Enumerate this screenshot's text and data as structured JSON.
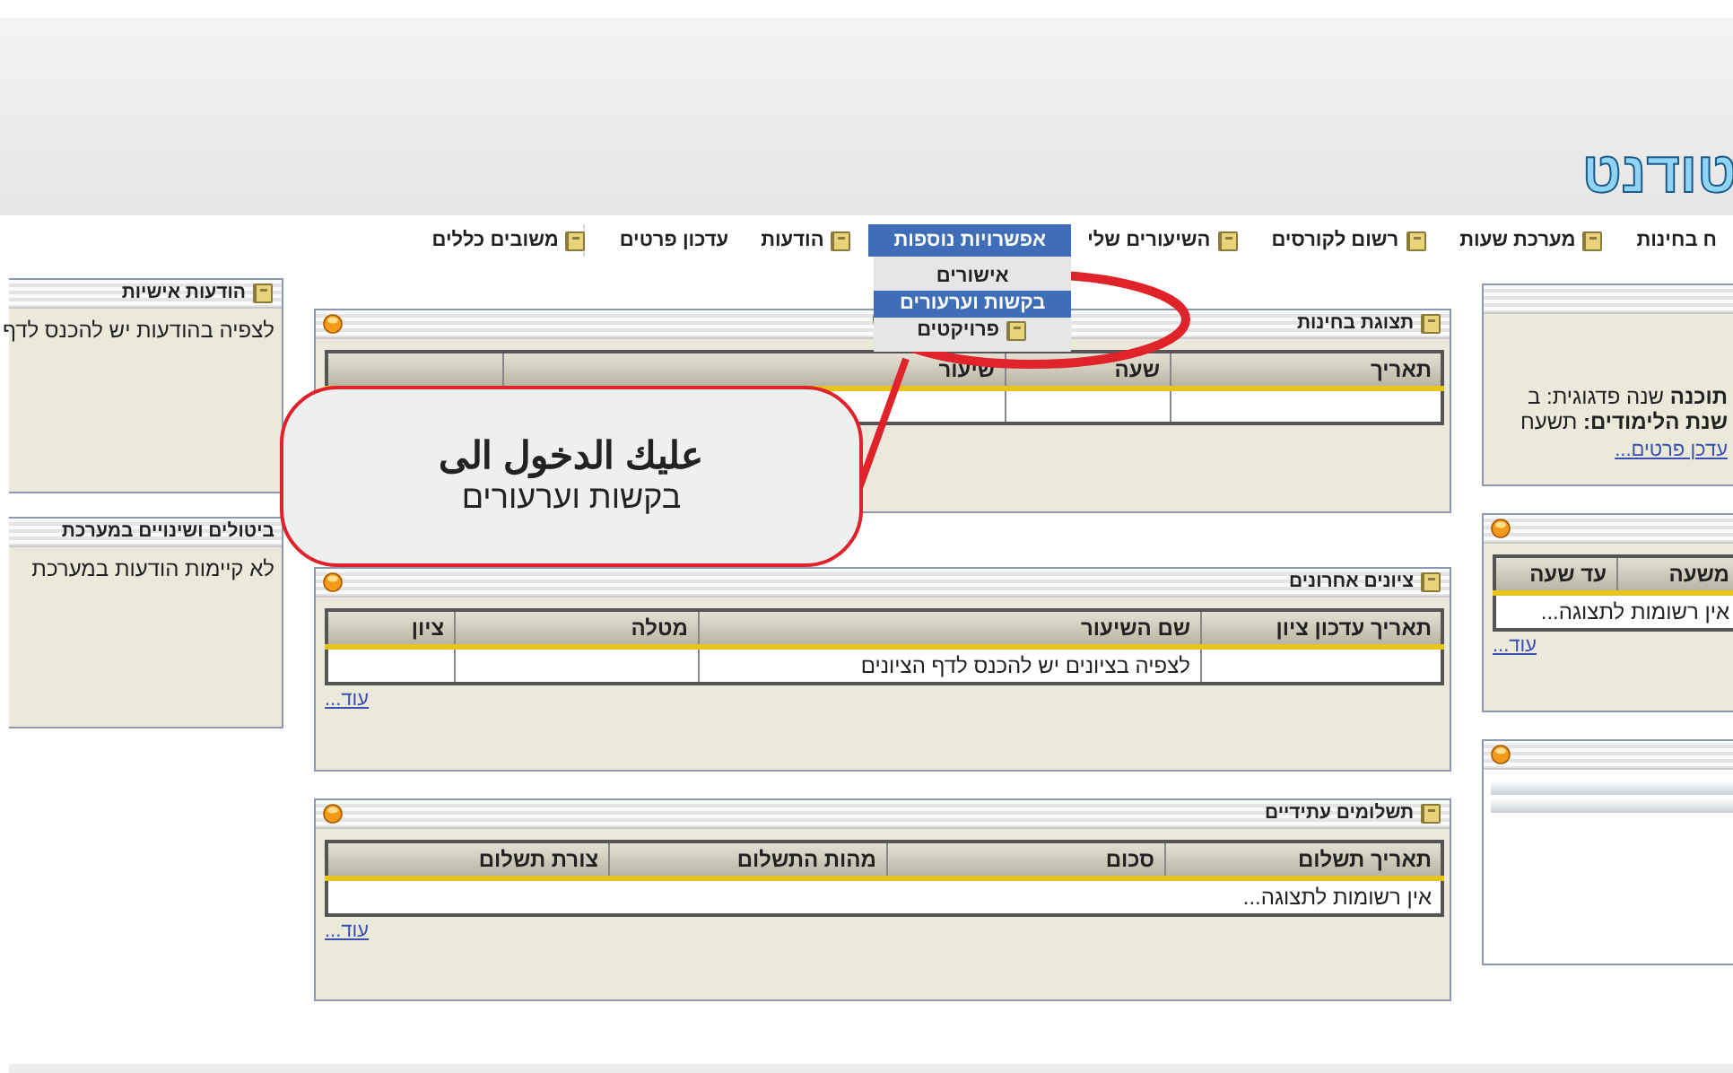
{
  "header": {
    "logo": "טודנט"
  },
  "nav": [
    {
      "label": "ח בחינות",
      "selected": false,
      "kind": "plain"
    },
    {
      "label": "מערכת שעות",
      "selected": false,
      "kind": "icon"
    },
    {
      "label": "רשום לקורסים",
      "selected": false,
      "kind": "icon"
    },
    {
      "label": "השיעורים שלי",
      "selected": false,
      "kind": "icon"
    },
    {
      "label": "אפשרויות נוספות",
      "selected": true,
      "kind": "plain",
      "menu": [
        {
          "label": "אישורים",
          "selected": false,
          "kind": "plain"
        },
        {
          "label": "בקשות וערעורים",
          "selected": true,
          "kind": "plain"
        },
        {
          "label": "פרויקטים",
          "selected": false,
          "kind": "icon"
        }
      ]
    },
    {
      "label": "הודעות",
      "selected": false,
      "kind": "icon"
    },
    {
      "label": "עדכון פרטים",
      "selected": false,
      "kind": "plain"
    },
    {
      "label": "משובים כללים",
      "selected": false,
      "kind": "icon"
    }
  ],
  "left_panels": [
    {
      "title": "הודעות אישיות",
      "text": "לצפיה בהודעות יש להכנס לדף",
      "kind": "icon"
    },
    {
      "title": "ביטולים ושינויים במערכת",
      "text": "לא קיימות הודעות במערכת",
      "kind": "plain"
    }
  ],
  "exams": {
    "title": "תצוגת בחינות",
    "columns": [
      "תאריך",
      "שעה",
      "שיעור"
    ]
  },
  "grades": {
    "title": "ציונים אחרונים",
    "columns": [
      "תאריך עדכון ציון",
      "שם השיעור",
      "מטלה",
      "ציון"
    ],
    "rows": [
      {
        "course": "לצפיה בציונים יש להכנס לדף הציונים"
      }
    ],
    "more": "עוד..."
  },
  "payments": {
    "title": "תשלומים עתידיים",
    "columns": [
      "תאריך תשלום",
      "סכום",
      "מהות התשלום",
      "צורת תשלום"
    ],
    "empty": "אין רשומות לתצוגה...",
    "more": "עוד..."
  },
  "profile": {
    "lines": [
      {
        "label": "תוכנה",
        "value": "שנה פדגוגית: ב"
      },
      {
        "label": "שנת הלימודים:",
        "value": "תשעח"
      }
    ],
    "link": "עדכן פרטים..."
  },
  "schedule": {
    "columns": [
      "משעה",
      "עד שעה"
    ],
    "empty": "אין רשומות לתצוגה...",
    "more": "עוד..."
  },
  "callout": {
    "title": "عليك الدخول الى",
    "text": "בקשות וערעורים"
  }
}
